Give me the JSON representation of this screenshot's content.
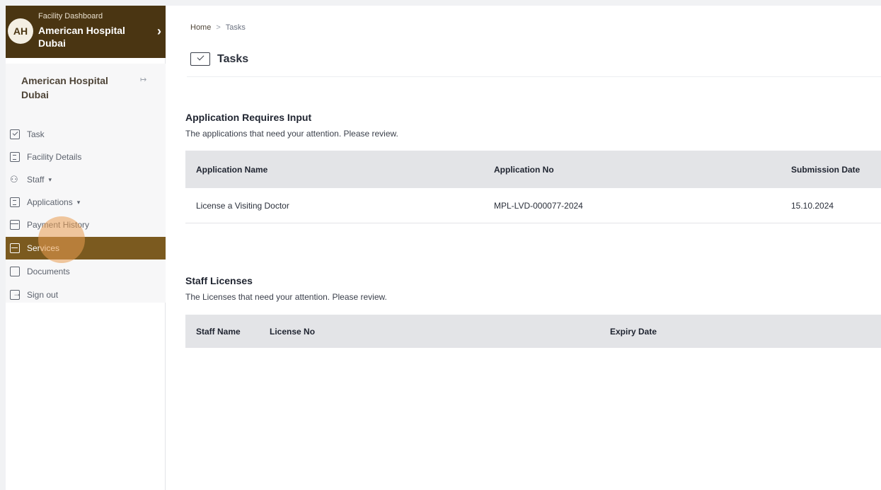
{
  "sidebar": {
    "facility_switcher": {
      "avatar_initials": "AH",
      "caption": "Facility Dashboard",
      "name": "American Hospital Dubai",
      "chevron": "›"
    },
    "facility_card": {
      "name": "American Hospital Dubai",
      "logout_icon": "↦"
    },
    "nav": [
      {
        "label": "Task",
        "icon": "task-icon"
      },
      {
        "label": "Facility Details",
        "icon": "facility-details-icon"
      },
      {
        "label": "Staff",
        "icon": "staff-icon",
        "caret": "▾"
      },
      {
        "label": "Applications",
        "icon": "applications-icon",
        "caret": "▾"
      },
      {
        "label": "Payment History",
        "icon": "payment-icon"
      },
      {
        "label": "Services",
        "icon": "services-icon",
        "active": true
      },
      {
        "label": "Documents",
        "icon": "documents-icon"
      },
      {
        "label": "Sign out",
        "icon": "sign-out-icon"
      }
    ]
  },
  "main": {
    "breadcrumb": {
      "home": "Home",
      "separator": ">",
      "current": "Tasks"
    },
    "title": "Tasks",
    "applications": {
      "title": "Application Requires Input",
      "subtitle": "The applications that need your attention. Please review.",
      "columns": [
        "Application Name",
        "Application No",
        "Submission Date"
      ],
      "rows": [
        {
          "name": "License a Visiting Doctor",
          "number": "MPL-LVD-000077-2024",
          "date": "15.10.2024"
        }
      ]
    },
    "licenses": {
      "title": "Staff Licenses",
      "subtitle": "The Licenses that need your attention. Please review.",
      "columns": [
        "Staff Name",
        "License No",
        "Expiry Date"
      ]
    }
  },
  "colors": {
    "brand_dark": "#4a3512",
    "active_nav": "#7b5a1f",
    "table_header": "#e3e4e7"
  }
}
